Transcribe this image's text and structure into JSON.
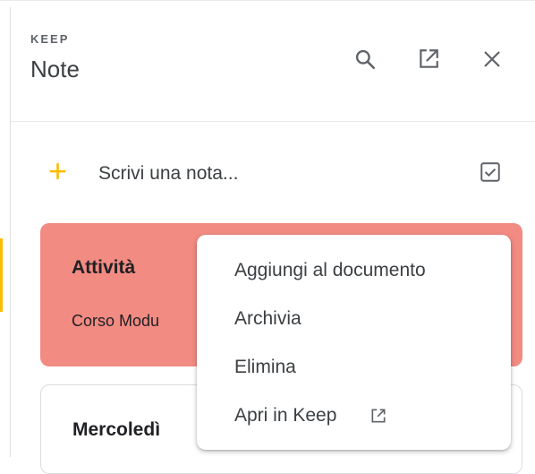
{
  "header": {
    "brand": "KEEP",
    "title": "Note",
    "icons": [
      "search-icon",
      "open-in-new-icon",
      "close-icon"
    ]
  },
  "new_note": {
    "placeholder": "Scrivi una nota...",
    "plus_glyph": "+",
    "list_icon": "checkbox-icon"
  },
  "notes": [
    {
      "title": "Attività",
      "body": "Corso Modu",
      "color": "#f28b82"
    },
    {
      "title": "Mercoledì",
      "color": "#ffffff"
    }
  ],
  "context_menu": {
    "items": [
      {
        "label": "Aggiungi al documento"
      },
      {
        "label": "Archivia"
      },
      {
        "label": "Elimina"
      },
      {
        "label": "Apri in Keep",
        "icon": "open-in-new-icon"
      }
    ]
  },
  "colors": {
    "accent": "#fbbc04",
    "note_red": "#f28b82"
  }
}
